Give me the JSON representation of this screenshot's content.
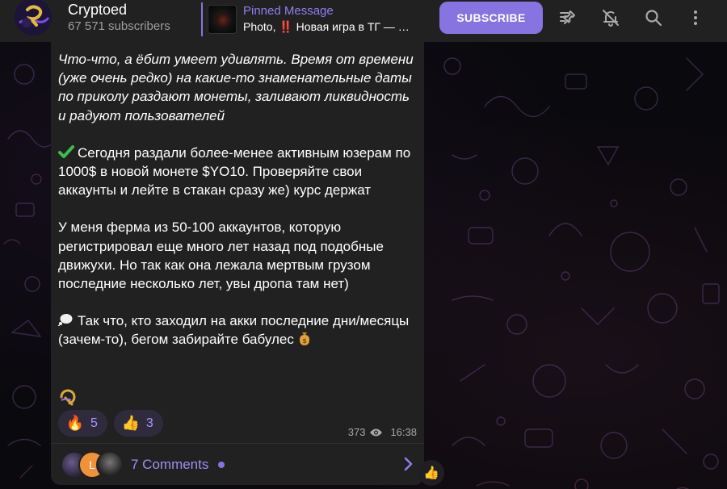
{
  "header": {
    "channel_title": "Cryptoed",
    "subscribers": "67 571 subscribers",
    "pinned_label": "Pinned Message",
    "pinned_preview": "Photo, ‼️ Новая игра в ТГ — …",
    "subscribe_label": "SUBSCRIBE",
    "icons": [
      "unpin-list-icon",
      "bell-off-icon",
      "search-icon",
      "more-vert-icon"
    ]
  },
  "message": {
    "paragraph1": "Что-что, а ёбит умеет удивлять. Время от времени (уже очень редко) на какие-то знаменательные даты по приколу раздают монеты, заливают ликвидность и радуют пользователей",
    "paragraph2": "Сегодня раздали более-менее активным юзерам по 1000$ в новой монете $YO10. Проверяйте свои аккаунты и лейте в стакан сразу же) курс держат",
    "paragraph3": "У меня ферма из 50-100 аккаунтов, которую регистрировал еще много лет назад под подобные движухи. Но так как она лежала мертвым грузом последние несколько лет, увы дропа там нет)",
    "paragraph4": "Так что, кто заходил на акки последние дни/месяцы (зачем-то), бегом забирайте бабулес",
    "reactions": [
      {
        "emoji": "🔥",
        "count": "5"
      },
      {
        "emoji": "👍",
        "count": "3"
      }
    ],
    "views": "373",
    "time": "16:38"
  },
  "comments": {
    "avatar_letter": "L",
    "label": "7 Comments"
  },
  "side_reaction": "👍",
  "colors": {
    "accent": "#8774e1",
    "header_bg": "#212121",
    "bubble_bg": "#212121"
  }
}
